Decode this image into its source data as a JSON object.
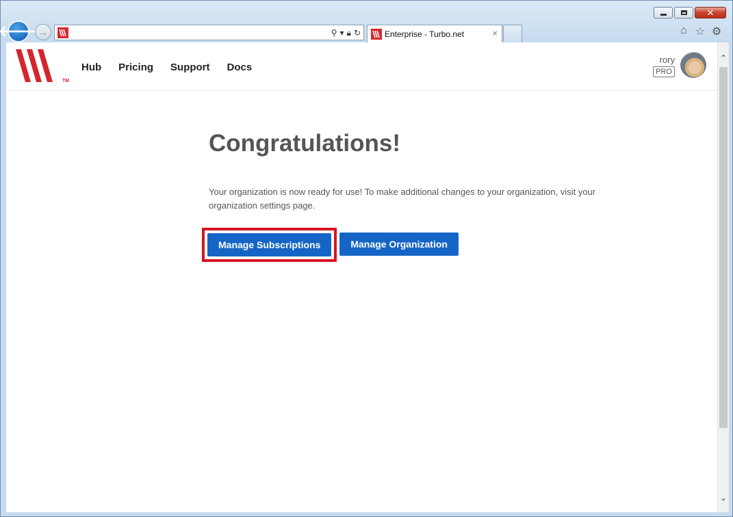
{
  "browser": {
    "address_value": "",
    "tab_title": "Enterprise - Turbo.net",
    "tab_close": "×",
    "caption": {
      "minimize": "",
      "maximize": "",
      "close": "✕"
    }
  },
  "site": {
    "nav": [
      "Hub",
      "Pricing",
      "Support",
      "Docs"
    ],
    "user": {
      "name": "rory",
      "badge": "PRO"
    }
  },
  "page": {
    "headline": "Congratulations!",
    "message": "Your organization is now ready for use! To make additional changes to your organization, visit your organization settings page.",
    "buttons": {
      "manage_subscriptions": "Manage Subscriptions",
      "manage_organization": "Manage Organization"
    }
  },
  "colors": {
    "brand_red": "#d5262e",
    "button_blue": "#1565c6",
    "highlight_red": "#d8141f"
  }
}
